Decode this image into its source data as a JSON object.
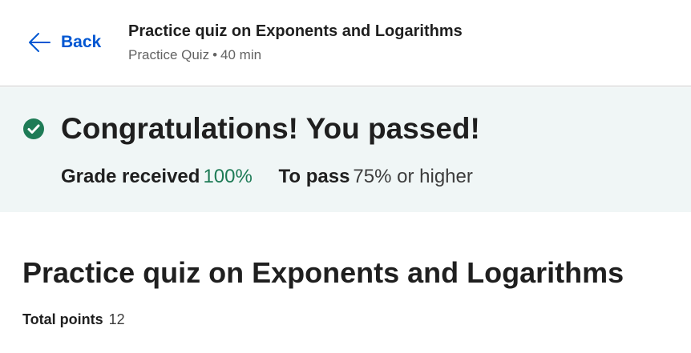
{
  "header": {
    "back_label": "Back",
    "course_title": "Practice quiz on Exponents and Logarithms",
    "meta_type": "Practice Quiz",
    "meta_separator": "•",
    "meta_duration": "40 min"
  },
  "banner": {
    "icon": "check-circle-icon",
    "title": "Congratulations! You passed!",
    "grade_label": "Grade received",
    "grade_value": "100%",
    "pass_label": "To pass",
    "pass_value": "75% or higher"
  },
  "quiz": {
    "title": "Practice quiz on Exponents and Logarithms",
    "points_label": "Total points",
    "points_value": "12"
  },
  "colors": {
    "link_blue": "#0056d2",
    "success_green": "#1e7b56",
    "banner_bg": "#f0f6f6"
  }
}
